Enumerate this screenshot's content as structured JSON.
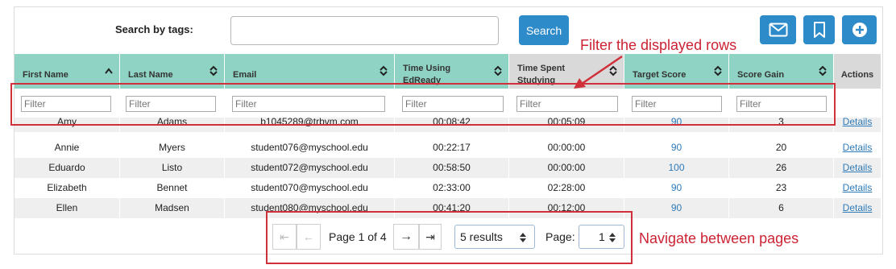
{
  "toolbar": {
    "search_label": "Search by tags:",
    "search_placeholder": "",
    "search_button": "Search",
    "icons": [
      "envelope-icon",
      "bookmark-icon",
      "plus-circle-icon"
    ],
    "accent_color": "#2e8bc9"
  },
  "table": {
    "header_color": "#8fd3c4",
    "header_color_alt": "#d9d9d9",
    "columns": [
      {
        "label": "First Name",
        "sort": "asc"
      },
      {
        "label": "Last Name",
        "sort": "both"
      },
      {
        "label": "Email",
        "sort": "both"
      },
      {
        "label": "Time Using EdReady",
        "sort": "both"
      },
      {
        "label": "Time Spent Studying",
        "sort": "both"
      },
      {
        "label": "Target Score",
        "sort": "both"
      },
      {
        "label": "Score Gain",
        "sort": "both"
      },
      {
        "label": "Actions",
        "sort": "none"
      }
    ],
    "filter_placeholder": "Filter",
    "rows": [
      [
        "Amy",
        "Adams",
        "b1045289@trbvm.com",
        "00:08:42",
        "00:05:09",
        "90",
        "3",
        "Details"
      ],
      [
        "Annie",
        "Myers",
        "student076@myschool.edu",
        "00:22:17",
        "00:00:00",
        "90",
        "20",
        "Details"
      ],
      [
        "Eduardo",
        "Listo",
        "student072@myschool.edu",
        "00:58:50",
        "00:00:00",
        "100",
        "26",
        "Details"
      ],
      [
        "Elizabeth",
        "Bennet",
        "student070@myschool.edu",
        "02:33:00",
        "02:28:00",
        "90",
        "23",
        "Details"
      ],
      [
        "Ellen",
        "Madsen",
        "student080@myschool.edu",
        "00:41:20",
        "00:12:00",
        "90",
        "6",
        "Details"
      ]
    ]
  },
  "pager": {
    "first": "⇤",
    "prev": "←",
    "page_text": "Page 1 of 4",
    "next": "→",
    "last": "⇥",
    "results_select": "5 results",
    "page_label": "Page:",
    "page_select": "1"
  },
  "annotations": {
    "filter_note": "Filter the displayed rows",
    "pager_note": "Navigate between pages",
    "color": "#d0303a"
  }
}
